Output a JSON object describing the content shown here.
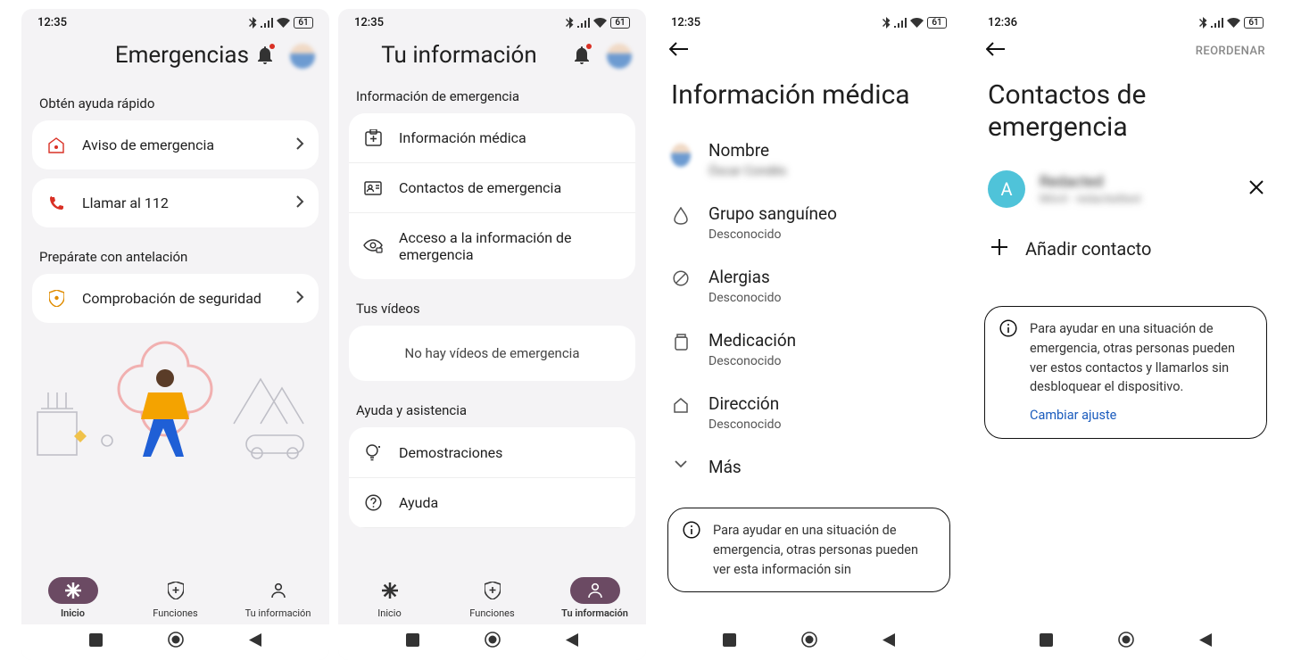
{
  "screens": [
    {
      "time": "12:35",
      "battery": "61",
      "title": "Emergencias",
      "sections": [
        {
          "label": "Obtén ayuda rápido",
          "items": [
            {
              "label": "Aviso de emergencia"
            },
            {
              "label": "Llamar al 112"
            }
          ]
        },
        {
          "label": "Prepárate con antelación",
          "items": [
            {
              "label": "Comprobación de seguridad"
            }
          ]
        }
      ],
      "nav": {
        "inicio": "Inicio",
        "funciones": "Funciones",
        "tuinfo": "Tu información"
      }
    },
    {
      "time": "12:35",
      "battery": "61",
      "title": "Tu información",
      "sections": [
        {
          "label": "Información de emergencia",
          "items": [
            {
              "label": "Información médica"
            },
            {
              "label": "Contactos de emergencia"
            },
            {
              "label": "Acceso a la información de emergencia"
            }
          ]
        },
        {
          "label": "Tus vídeos",
          "empty": "No hay vídeos de emergencia"
        },
        {
          "label": "Ayuda y asistencia",
          "items": [
            {
              "label": "Demostraciones"
            },
            {
              "label": "Ayuda"
            }
          ]
        }
      ],
      "nav": {
        "inicio": "Inicio",
        "funciones": "Funciones",
        "tuinfo": "Tu información"
      }
    },
    {
      "time": "12:35",
      "battery": "61",
      "title": "Información médica",
      "fields": [
        {
          "label": "Nombre",
          "value": "Óscar Condés",
          "redacted": true
        },
        {
          "label": "Grupo sanguíneo",
          "value": "Desconocido"
        },
        {
          "label": "Alergias",
          "value": "Desconocido"
        },
        {
          "label": "Medicación",
          "value": "Desconocido"
        },
        {
          "label": "Dirección",
          "value": "Desconocido"
        }
      ],
      "more": "Más",
      "notice": "Para ayudar en una situación de emergencia, otras personas pueden ver esta información sin"
    },
    {
      "time": "12:36",
      "battery": "61",
      "reorder": "REORDENAR",
      "title": "Contactos de emergencia",
      "contact": {
        "initial": "A",
        "name": "Redacted",
        "sub": "Móvil · redactedtext"
      },
      "add": "Añadir contacto",
      "notice": "Para ayudar en una situación de emergencia, otras personas pueden ver estos contactos y llamarlos sin desbloquear el dispositivo.",
      "notice_link": "Cambiar ajuste"
    }
  ]
}
